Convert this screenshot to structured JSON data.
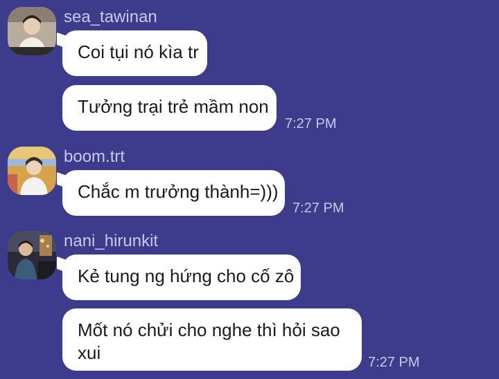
{
  "messages": [
    {
      "sender": "sea_tawinan",
      "avatar_icon": "user-avatar-icon",
      "bubbles": [
        {
          "text": "Coi tụi nó kìa tr"
        },
        {
          "text": "Tưởng trại trẻ mầm non",
          "time": "7:27 PM"
        }
      ]
    },
    {
      "sender": "boom.trt",
      "avatar_icon": "user-avatar-icon",
      "bubbles": [
        {
          "text": "Chắc m trưởng thành=)))",
          "time": "7:27 PM"
        }
      ]
    },
    {
      "sender": "nani_hirunkit",
      "avatar_icon": "user-avatar-icon",
      "bubbles": [
        {
          "text": "Kẻ tung ng hứng cho cố zô"
        },
        {
          "text": "Mốt nó chửi cho nghe thì hỏi sao xui",
          "time": "7:27 PM"
        }
      ]
    }
  ],
  "colors": {
    "background": "#3d3c8c",
    "bubble": "#ffffff",
    "meta_text": "#c9c8ea"
  }
}
